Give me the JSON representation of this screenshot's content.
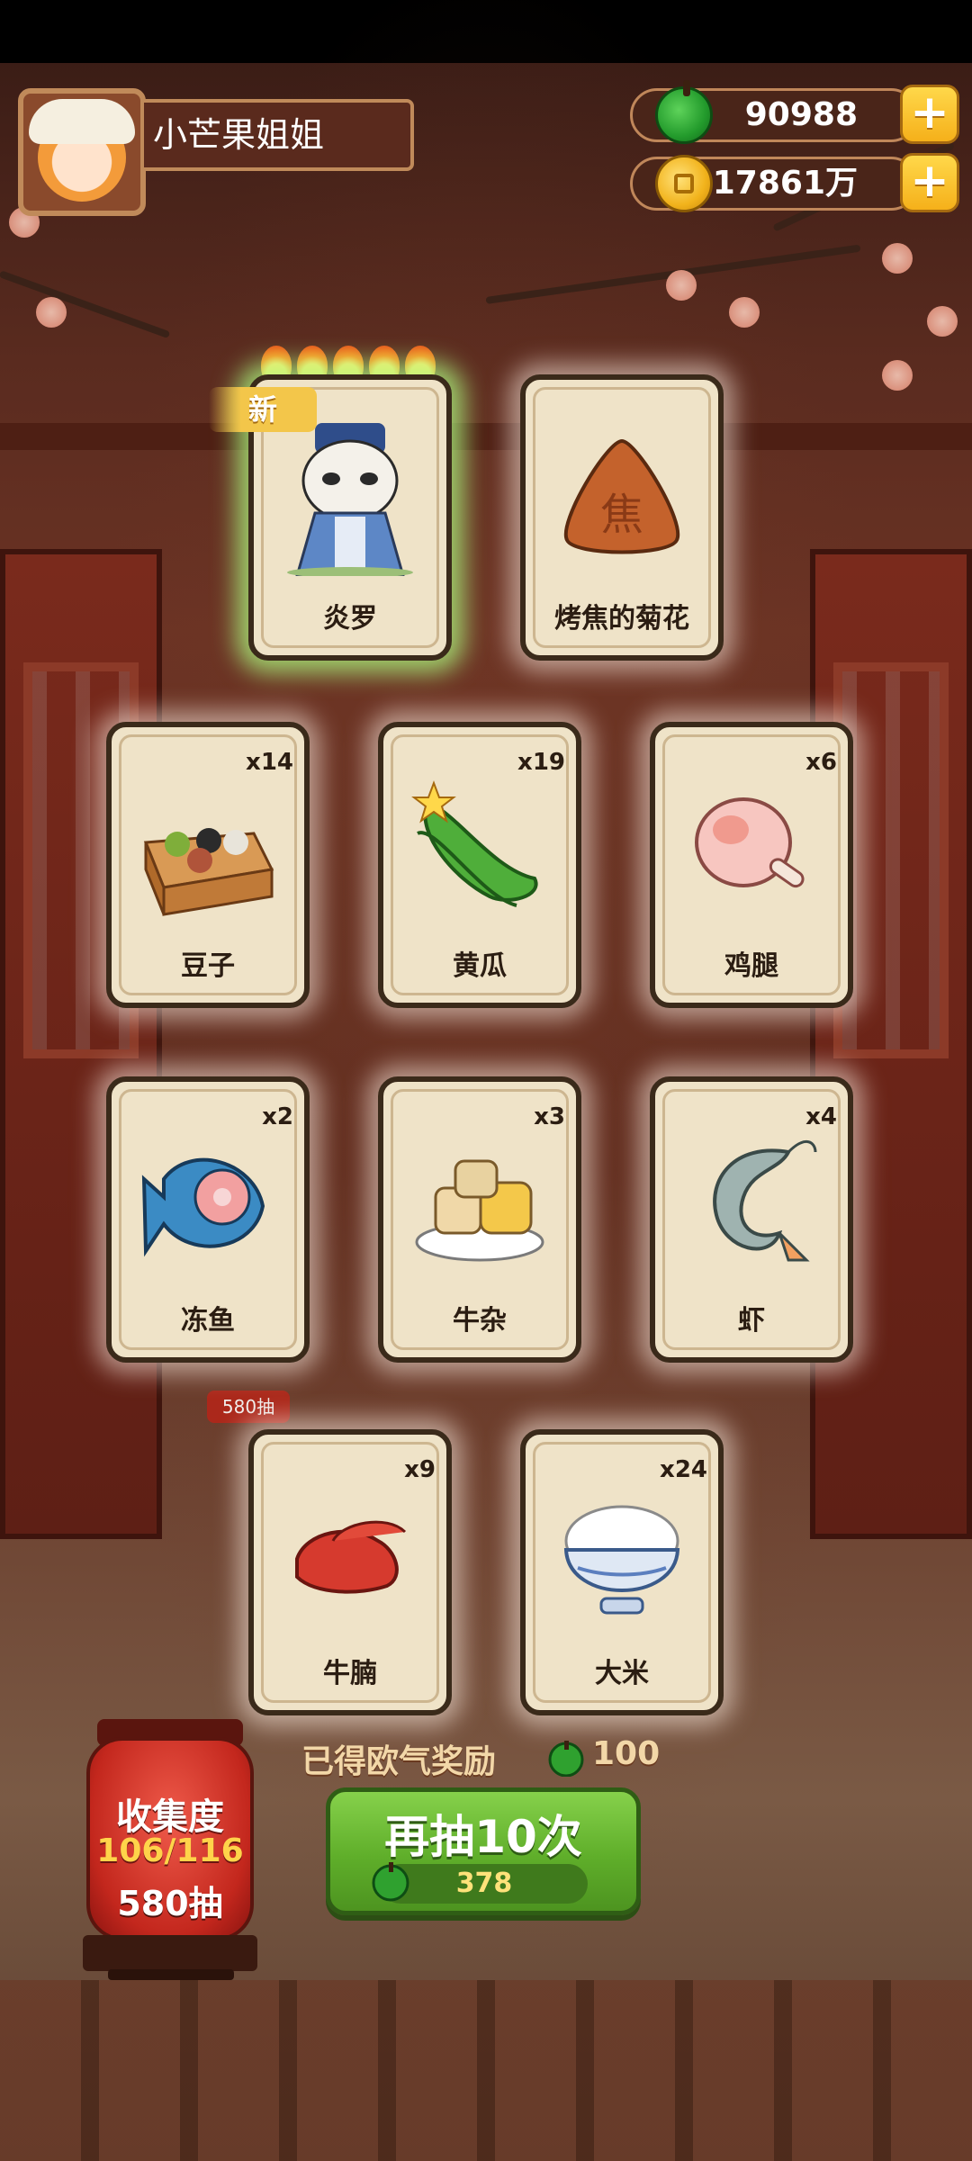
{
  "player": {
    "name": "小芒果姐姐"
  },
  "resources": {
    "gems": {
      "value": "90988",
      "icon": "green-apple-icon"
    },
    "coins": {
      "value": "17861万",
      "icon": "gold-coin-icon"
    }
  },
  "featured": [
    {
      "name": "炎罗",
      "badge": "新",
      "stars": 5,
      "icon": "panda-character-icon"
    },
    {
      "name": "烤焦的菊花",
      "icon": "burnt-cookie-icon"
    }
  ],
  "items": [
    {
      "name": "豆子",
      "count": "x14",
      "icon": "bean-box-icon"
    },
    {
      "name": "黄瓜",
      "count": "x19",
      "icon": "cucumber-icon"
    },
    {
      "name": "鸡腿",
      "count": "x6",
      "icon": "chicken-leg-icon"
    },
    {
      "name": "冻鱼",
      "count": "x2",
      "icon": "frozen-fish-icon"
    },
    {
      "name": "牛杂",
      "count": "x3",
      "icon": "beef-offal-icon"
    },
    {
      "name": "虾",
      "count": "x4",
      "icon": "shrimp-icon"
    },
    {
      "name": "牛腩",
      "count": "x9",
      "icon": "beef-brisket-icon"
    },
    {
      "name": "大米",
      "count": "x24",
      "icon": "rice-bowl-icon"
    }
  ],
  "reward": {
    "label": "已得欧气奖励",
    "value": "100"
  },
  "draw_button": {
    "label": "再抽10次",
    "cost": "378"
  },
  "collection": {
    "title": "收集度",
    "progress": "106/116",
    "draws": "580抽"
  },
  "background_tag": "580抽",
  "colors": {
    "accent_green": "#5fae2a",
    "gold": "#f5b01a",
    "lantern_red": "#c3271d",
    "card_bg": "#efe3c8"
  }
}
